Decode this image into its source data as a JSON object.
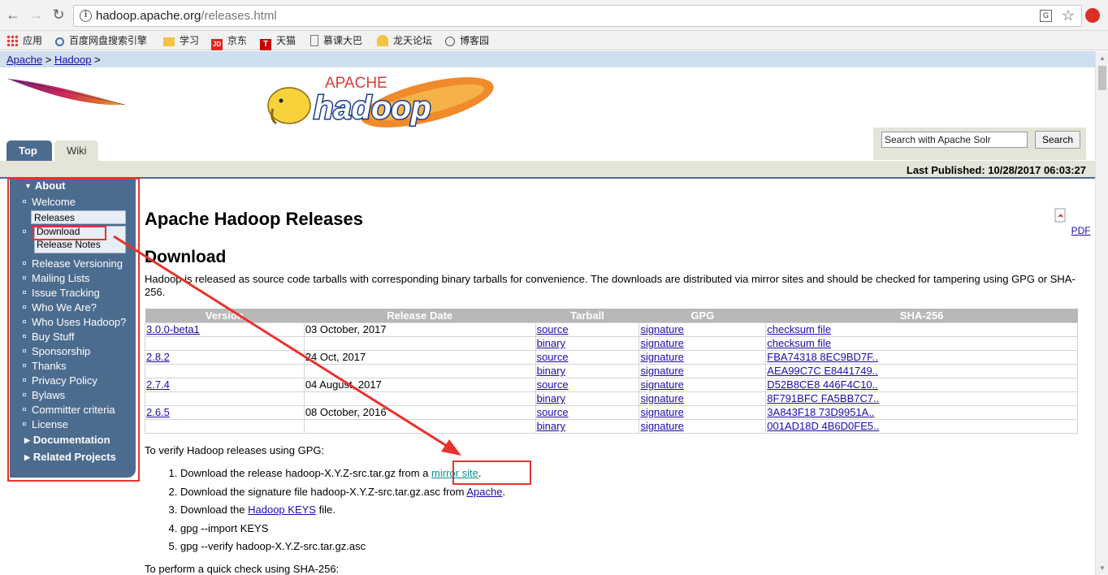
{
  "browser": {
    "url_host": "hadoop.apache.org",
    "url_path": "/releases.html",
    "translate_icon_label": "G",
    "bookmarks": [
      {
        "label": "应用",
        "icon": "apps-grid-icon"
      },
      {
        "label": "百度网盘搜索引擎",
        "icon": "link-icon"
      },
      {
        "label": "学习",
        "icon": "folder-icon"
      },
      {
        "label": "京东",
        "icon": "jd-icon"
      },
      {
        "label": "天猫",
        "icon": "tmall-icon"
      },
      {
        "label": "慕课大巴",
        "icon": "page-icon"
      },
      {
        "label": "龙天论坛",
        "icon": "page-icon"
      },
      {
        "label": "博客园",
        "icon": "page-icon"
      }
    ]
  },
  "breadcrumb": {
    "apache": "Apache",
    "sep1": ">",
    "hadoop": "Hadoop",
    "sep2": ">"
  },
  "logo": {
    "apache_word": "APACHE",
    "hadoop_word": "hadoop"
  },
  "tabs": {
    "top": "Top",
    "wiki": "Wiki"
  },
  "search": {
    "placeholder": "Search with Apache Solr",
    "button": "Search"
  },
  "last_published": "Last Published: 10/28/2017 06:03:27",
  "sidebar": {
    "about": "About",
    "items": [
      "Welcome",
      "Releases",
      "Download",
      "Release Notes",
      "Release Versioning",
      "Mailing Lists",
      "Issue Tracking",
      "Who We Are?",
      "Who Uses Hadoop?",
      "Buy Stuff",
      "Sponsorship",
      "Thanks",
      "Privacy Policy",
      "Bylaws",
      "Committer criteria",
      "License"
    ],
    "documentation": "Documentation",
    "related": "Related Projects"
  },
  "main": {
    "title": "Apache Hadoop Releases",
    "pdf_label": "PDF",
    "download_heading": "Download",
    "intro": "Hadoop is released as source code tarballs with corresponding binary tarballs for convenience. The downloads are distributed via mirror sites and should be checked for tampering using GPG or SHA-256.",
    "table": {
      "headers": [
        "Version",
        "Release Date",
        "Tarball",
        "GPG",
        "SHA-256"
      ],
      "rows": [
        {
          "version": "3.0.0-beta1",
          "date": "03 October, 2017",
          "tarball": "source",
          "gpg": "signature",
          "sha": "checksum file"
        },
        {
          "version": "",
          "date": "",
          "tarball": "binary",
          "gpg": "signature",
          "sha": "checksum file"
        },
        {
          "version": "2.8.2",
          "date": "24 Oct, 2017",
          "tarball": "source",
          "gpg": "signature",
          "sha": "FBA74318 8EC9BD7F.."
        },
        {
          "version": "",
          "date": "",
          "tarball": "binary",
          "gpg": "signature",
          "sha": "AEA99C7C E8441749.."
        },
        {
          "version": "2.7.4",
          "date": "04 August, 2017",
          "tarball": "source",
          "gpg": "signature",
          "sha": "D52B8CE8 446F4C10.."
        },
        {
          "version": "",
          "date": "",
          "tarball": "binary",
          "gpg": "signature",
          "sha": "8F791BFC FA5BB7C7.."
        },
        {
          "version": "2.6.5",
          "date": "08 October, 2016",
          "tarball": "source",
          "gpg": "signature",
          "sha": "3A843F18 73D9951A.."
        },
        {
          "version": "",
          "date": "",
          "tarball": "binary",
          "gpg": "signature",
          "sha": "001AD18D 4B6D0FE5.."
        }
      ]
    },
    "verify_title": "To verify Hadoop releases using GPG:",
    "steps": {
      "s1_pre": "Download the release hadoop-X.Y.Z-src.tar.gz from a ",
      "s1_link": "mirror site",
      "s1_post": ".",
      "s2_pre": "Download the signature file hadoop-X.Y.Z-src.tar.gz.asc from ",
      "s2_link": "Apache",
      "s2_post": ".",
      "s3_pre": "Download the ",
      "s3_link": "Hadoop KEYS",
      "s3_post": " file.",
      "s4": "gpg --import KEYS",
      "s5": "gpg --verify hadoop-X.Y.Z-src.tar.gz.asc"
    },
    "quick_check": "To perform a quick check using SHA-256:"
  },
  "colors": {
    "nav_blue": "#4c6c8f",
    "highlight_red": "#e8322c",
    "breadcrumb_bg": "#cedfef",
    "header_gray": "#b8b8b8"
  }
}
